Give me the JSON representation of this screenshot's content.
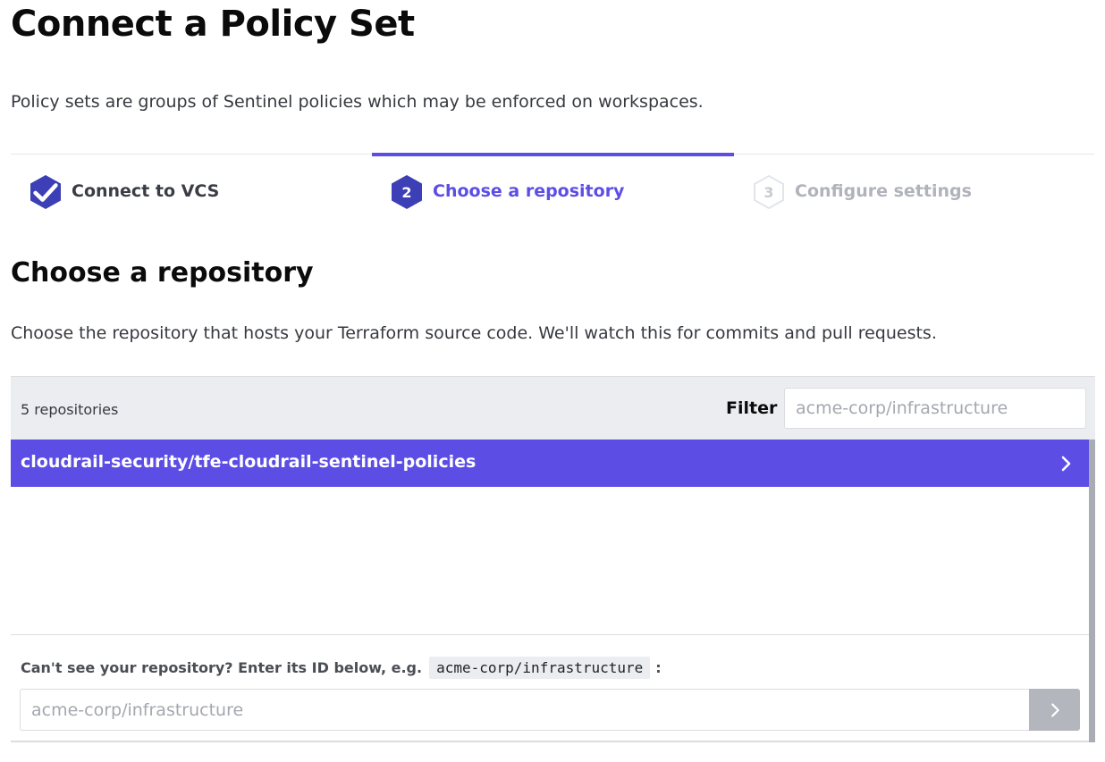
{
  "page": {
    "title": "Connect a Policy Set",
    "description": "Policy sets are groups of Sentinel policies which may be enforced on workspaces."
  },
  "steps": [
    {
      "number": "1",
      "label": "Connect to VCS",
      "state": "done"
    },
    {
      "number": "2",
      "label": "Choose a repository",
      "state": "active"
    },
    {
      "number": "3",
      "label": "Configure settings",
      "state": "pending"
    }
  ],
  "section": {
    "title": "Choose a repository",
    "description": "Choose the repository that hosts your Terraform source code. We'll watch this for commits and pull requests."
  },
  "repositories": {
    "count_label": "5 repositories",
    "filter_label": "Filter",
    "filter_placeholder": "acme-corp/infrastructure",
    "filter_value": "",
    "items": [
      {
        "name": "cloudrail-security/tfe-cloudrail-sentinel-policies",
        "selected": true
      }
    ]
  },
  "manual_entry": {
    "hint_prefix": "Can't see your repository? Enter its ID below, e.g.",
    "example": "acme-corp/infrastructure",
    "hint_suffix": ":",
    "placeholder": "acme-corp/infrastructure",
    "value": ""
  },
  "colors": {
    "accent": "#5c4ee5",
    "step_done": "#3c3fb5",
    "header_bg": "#ebedf1",
    "submit_disabled": "#b3b6bd"
  },
  "icons": {
    "step_done": "check-icon",
    "row_chevron": "chevron-right-icon",
    "submit": "chevron-right-icon"
  }
}
